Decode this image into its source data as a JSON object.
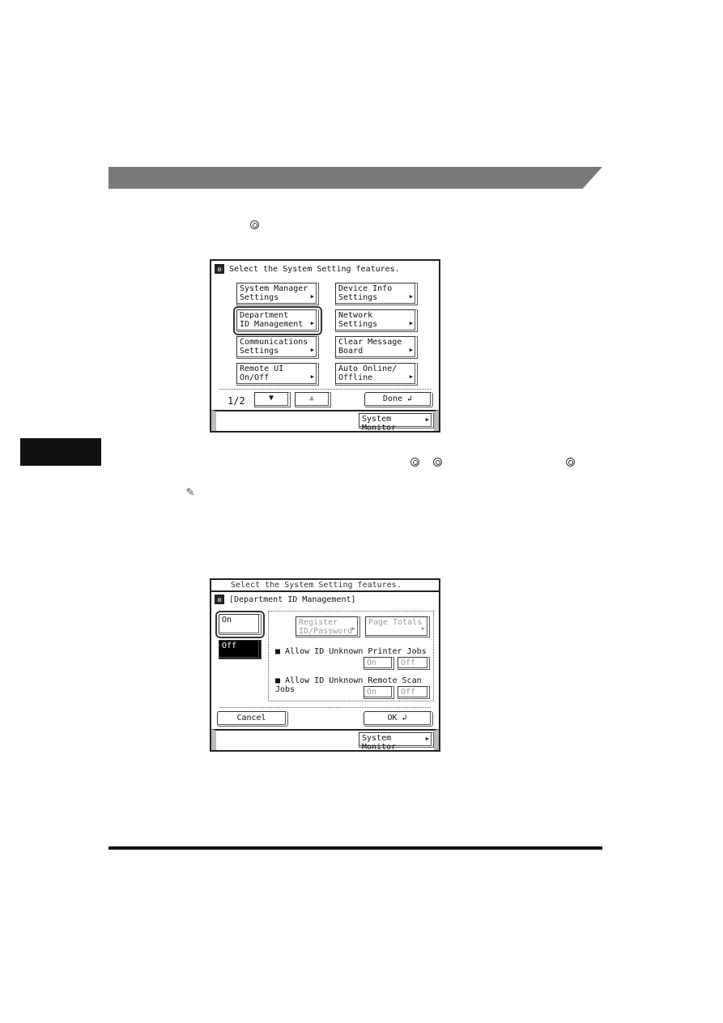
{
  "screen1": {
    "title": "Select the System Setting features.",
    "buttons": [
      "System Manager\nSettings",
      "Device Info\nSettings",
      "Department\nID Management",
      "Network\nSettings",
      "Communications\nSettings",
      "Clear Message\nBoard",
      "Remote UI\nOn/Off",
      "Auto Online/\nOffline"
    ],
    "selected": "Department ID Management",
    "page": "1/2",
    "done": "Done",
    "system_monitor": "System Monitor"
  },
  "screen2": {
    "behind_title": "Select the System Setting features.",
    "title": "[Department ID Management]",
    "on": "On",
    "off": "Off",
    "register": "Register\nID/Password",
    "page_totals": "Page Totals",
    "printer_jobs": "Allow ID Unknown Printer Jobs",
    "scan_jobs": "Allow ID Unknown Remote Scan Jobs",
    "opt_on": "On",
    "opt_off": "Off",
    "cancel": "Cancel",
    "ok": "OK",
    "system_monitor": "System Monitor"
  },
  "icons": {
    "key": "settings-key-icon",
    "note": "pencil-icon"
  }
}
